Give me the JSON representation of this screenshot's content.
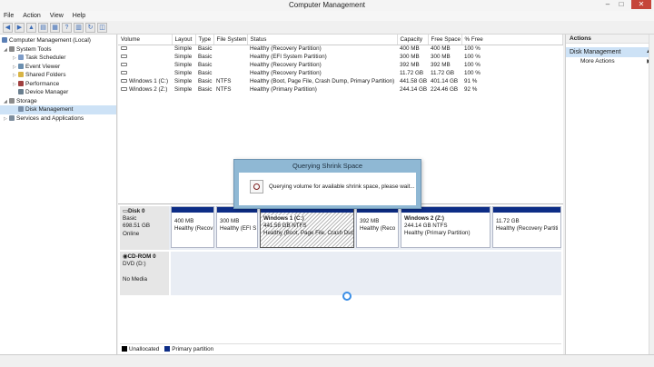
{
  "window": {
    "title": "Computer Management"
  },
  "menu": [
    "File",
    "Action",
    "View",
    "Help"
  ],
  "tree": [
    {
      "label": "Computer Management (Local)",
      "level": 0,
      "expanded": true
    },
    {
      "label": "System Tools",
      "level": 1,
      "expanded": true
    },
    {
      "label": "Task Scheduler",
      "level": 2
    },
    {
      "label": "Event Viewer",
      "level": 2
    },
    {
      "label": "Shared Folders",
      "level": 2
    },
    {
      "label": "Performance",
      "level": 2
    },
    {
      "label": "Device Manager",
      "level": 2
    },
    {
      "label": "Storage",
      "level": 1,
      "expanded": true
    },
    {
      "label": "Disk Management",
      "level": 2,
      "selected": true
    },
    {
      "label": "Services and Applications",
      "level": 1
    }
  ],
  "volumes": {
    "columns": [
      "Volume",
      "Layout",
      "Type",
      "File System",
      "Status",
      "Capacity",
      "Free Space",
      "% Free"
    ],
    "rows": [
      [
        "",
        "Simple",
        "Basic",
        "",
        "Healthy (Recovery Partition)",
        "400 MB",
        "400 MB",
        "100 %"
      ],
      [
        "",
        "Simple",
        "Basic",
        "",
        "Healthy (EFI System Partition)",
        "300 MB",
        "300 MB",
        "100 %"
      ],
      [
        "",
        "Simple",
        "Basic",
        "",
        "Healthy (Recovery Partition)",
        "392 MB",
        "392 MB",
        "100 %"
      ],
      [
        "",
        "Simple",
        "Basic",
        "",
        "Healthy (Recovery Partition)",
        "11.72 GB",
        "11.72 GB",
        "100 %"
      ],
      [
        "Windows 1 (C:)",
        "Simple",
        "Basic",
        "NTFS",
        "Healthy (Boot, Page File, Crash Dump, Primary Partition)",
        "441.58 GB",
        "401.14 GB",
        "91 %"
      ],
      [
        "Windows 2 (Z:)",
        "Simple",
        "Basic",
        "NTFS",
        "Healthy (Primary Partition)",
        "244.14 GB",
        "224.46 GB",
        "92 %"
      ]
    ]
  },
  "disk0": {
    "name": "Disk 0",
    "type": "Basic",
    "size": "698.51 GB",
    "state": "Online",
    "partitions": [
      {
        "title": "",
        "size": "400 MB",
        "status": "Healthy (Recov"
      },
      {
        "title": "",
        "size": "300 MB",
        "status": "Healthy (EFI S"
      },
      {
        "title": "Windows 1  (C:)",
        "size": "441.58 GB NTFS",
        "status": "Healthy (Boot, Page File, Crash Dum"
      },
      {
        "title": "",
        "size": "392 MB",
        "status": "Healthy (Reco"
      },
      {
        "title": "Windows 2  (Z:)",
        "size": "244.14 GB NTFS",
        "status": "Healthy (Primary Partition)"
      },
      {
        "title": "",
        "size": "11.72 GB",
        "status": "Healthy (Recovery Partiti"
      }
    ]
  },
  "cdrom": {
    "name": "CD-ROM 0",
    "drive": "DVD (D:)",
    "media": "No Media"
  },
  "legend": [
    "Unallocated",
    "Primary partition"
  ],
  "legend_colors": [
    "#000000",
    "#0d2d86"
  ],
  "actions": {
    "header": "Actions",
    "section": "Disk Management",
    "item": "More Actions"
  },
  "dialog": {
    "title": "Querying Shrink Space",
    "message": "Querying volume for available shrink space, please wait..."
  }
}
